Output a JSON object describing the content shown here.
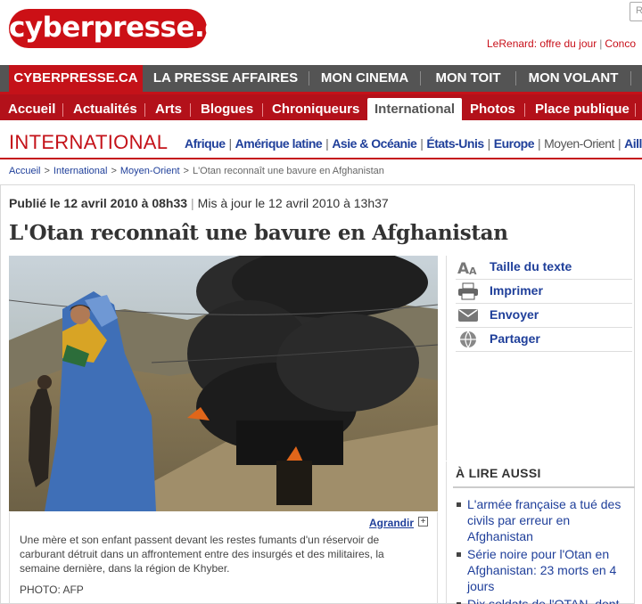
{
  "header": {
    "logo": "cyberpresse.ca",
    "search_placeholder": "R",
    "links": [
      "LeRenard: offre du jour",
      "Conco"
    ]
  },
  "nav_primary": [
    "CYBERPRESSE.CA",
    "LA PRESSE AFFAIRES",
    "MON CINEMA",
    "MON TOIT",
    "MON VOLANT"
  ],
  "nav_secondary": [
    "Accueil",
    "Actualités",
    "Arts",
    "Blogues",
    "Chroniqueurs",
    "International",
    "Photos",
    "Place publique"
  ],
  "section": {
    "title": "INTERNATIONAL",
    "sub_links": [
      "Afrique",
      "Amérique latine",
      "Asie & Océanie",
      "États-Unis",
      "Europe",
      "Moyen-Orient",
      "Aille"
    ]
  },
  "breadcrumb": [
    "Accueil",
    "International",
    "Moyen-Orient",
    "L'Otan reconnaît une bavure en Afghanistan"
  ],
  "article": {
    "published": "Publié le 12 avril 2010 à 08h33",
    "updated": "Mis à jour le 12 avril 2010 à 13h37",
    "headline": "L'Otan reconnaît une bavure en Afghanistan",
    "enlarge_label": "Agrandir",
    "caption": "Une mère et son enfant passent devant les restes fumants d'un réservoir de carburant détruit dans un affrontement entre des insurgés et des militaires, la semaine dernière, dans la région de Khyber.",
    "credit": "PHOTO: AFP"
  },
  "tools": [
    {
      "label": "Taille du texte",
      "icon": "text-size-icon"
    },
    {
      "label": "Imprimer",
      "icon": "printer-icon"
    },
    {
      "label": "Envoyer",
      "icon": "envelope-icon"
    },
    {
      "label": "Partager",
      "icon": "globe-icon"
    }
  ],
  "related": {
    "title": "À LIRE AUSSI",
    "items": [
      "L'armée française a tué des civils par erreur en Afghanistan",
      "Série noire pour l'Otan en Afghanistan: 23 morts en 4 jours",
      "Dix soldats de l'OTAN, dont"
    ]
  },
  "colors": {
    "brand_red": "#c41219",
    "dark_gray_nav": "#545454",
    "link_blue": "#1f3f9a"
  }
}
